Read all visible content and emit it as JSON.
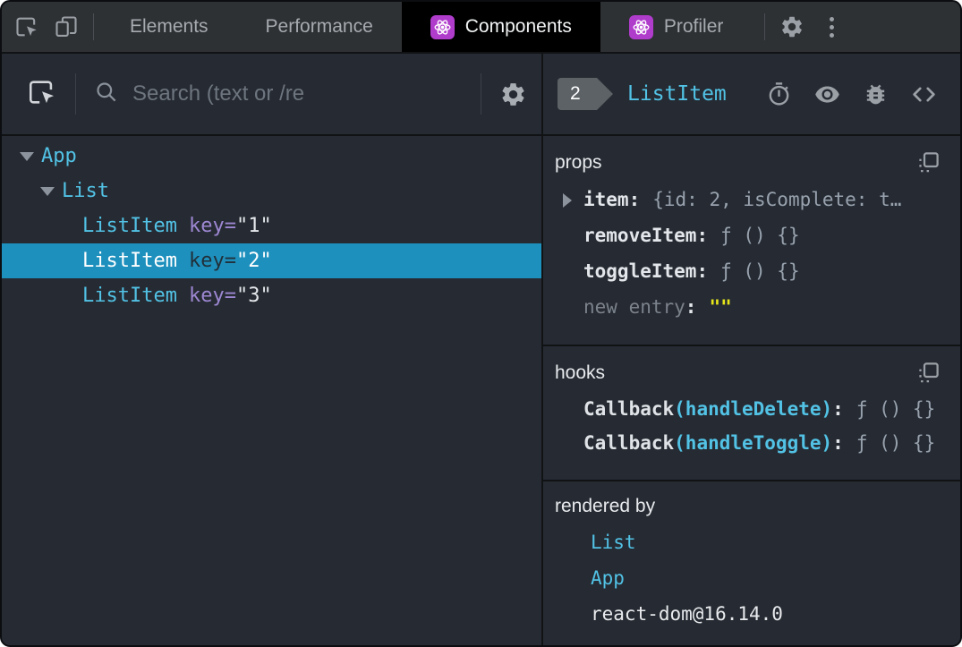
{
  "colors": {
    "selected_row": "#1e90bd",
    "component_cyan": "#52c2e5",
    "attribute_purple": "#9d87d2",
    "editable_yellow": "#e5e51a",
    "react_icon_purple": "#b03ccc",
    "panel_background": "#262b33",
    "topbar_background": "#2e3134"
  },
  "topbar": {
    "icons": [
      "inspect-element-icon",
      "device-toolbar-icon",
      "settings-gear-icon",
      "kebab-menu-icon"
    ],
    "tabs": [
      {
        "label": "Elements",
        "active": false,
        "react_icon": false
      },
      {
        "label": "Performance",
        "active": false,
        "react_icon": false
      },
      {
        "label": "Components",
        "active": true,
        "react_icon": true
      },
      {
        "label": "Profiler",
        "active": false,
        "react_icon": true
      }
    ]
  },
  "left": {
    "toolbar": {
      "inspect_icon": "inspect-component-icon",
      "search_placeholder": "Search (text or /re",
      "search_value": "",
      "gear_icon": "settings-gear-icon"
    },
    "tree": [
      {
        "name": "App",
        "level": 0,
        "expanded": true
      },
      {
        "name": "List",
        "level": 1,
        "expanded": true
      },
      {
        "name": "ListItem",
        "level": 2,
        "key": "1"
      },
      {
        "name": "ListItem",
        "level": 2,
        "key": "2",
        "selected": true
      },
      {
        "name": "ListItem",
        "level": 2,
        "key": "3"
      }
    ]
  },
  "right": {
    "header": {
      "badge": "2",
      "title": "ListItem",
      "icons": [
        "timer-icon",
        "eye-icon",
        "bug-icon",
        "view-source-icon"
      ]
    },
    "props": {
      "title": "props",
      "copy_icon": "copy-icon",
      "rows": [
        {
          "name": "item",
          "value": "{id: 2, isComplete: t…",
          "expandable": true
        },
        {
          "name": "removeItem",
          "value": "ƒ () {}"
        },
        {
          "name": "toggleItem",
          "value": "ƒ () {}"
        },
        {
          "name": "new entry",
          "value": "\"\"",
          "editable": true
        }
      ]
    },
    "hooks": {
      "title": "hooks",
      "copy_icon": "copy-icon",
      "rows": [
        {
          "prefix": "Callback",
          "paren": "(handleDelete)",
          "value": "ƒ () {}"
        },
        {
          "prefix": "Callback",
          "paren": "(handleToggle)",
          "value": "ƒ () {}"
        }
      ]
    },
    "rendered_by": {
      "title": "rendered by",
      "items": [
        {
          "label": "List",
          "link": true
        },
        {
          "label": "App",
          "link": true
        },
        {
          "label": "react-dom@16.14.0",
          "link": false
        }
      ]
    }
  }
}
